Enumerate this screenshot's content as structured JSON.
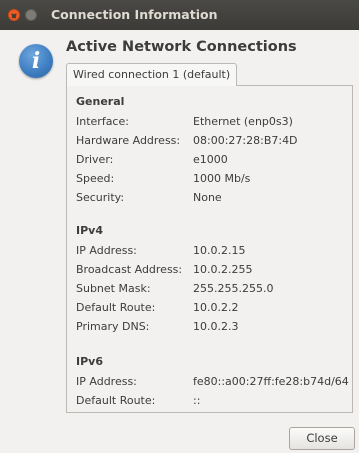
{
  "window": {
    "title": "Connection Information"
  },
  "header": {
    "title": "Active Network Connections"
  },
  "tabs": [
    {
      "label": "Wired connection 1 (default)"
    }
  ],
  "general": {
    "title": "General",
    "rows": [
      {
        "label": "Interface:",
        "value": "Ethernet (enp0s3)"
      },
      {
        "label": "Hardware Address:",
        "value": "08:00:27:28:B7:4D"
      },
      {
        "label": "Driver:",
        "value": "e1000"
      },
      {
        "label": "Speed:",
        "value": "1000 Mb/s"
      },
      {
        "label": "Security:",
        "value": "None"
      }
    ]
  },
  "ipv4": {
    "title": "IPv4",
    "rows": [
      {
        "label": "IP Address:",
        "value": "10.0.2.15"
      },
      {
        "label": "Broadcast Address:",
        "value": "10.0.2.255"
      },
      {
        "label": "Subnet Mask:",
        "value": "255.255.255.0"
      },
      {
        "label": "Default Route:",
        "value": "10.0.2.2"
      },
      {
        "label": "Primary DNS:",
        "value": "10.0.2.3"
      }
    ]
  },
  "ipv6": {
    "title": "IPv6",
    "rows": [
      {
        "label": "IP Address:",
        "value": "fe80::a00:27ff:fe28:b74d/64"
      },
      {
        "label": "Default Route:",
        "value": "::"
      }
    ]
  },
  "buttons": {
    "close_label": "Close"
  },
  "icons": {
    "info": "info-icon",
    "close": "close-icon",
    "minimize": "minimize-icon"
  },
  "colors": {
    "titlebar": "#3c3b37",
    "close_button": "#f15d22",
    "info_icon": "#3f7fc3"
  }
}
